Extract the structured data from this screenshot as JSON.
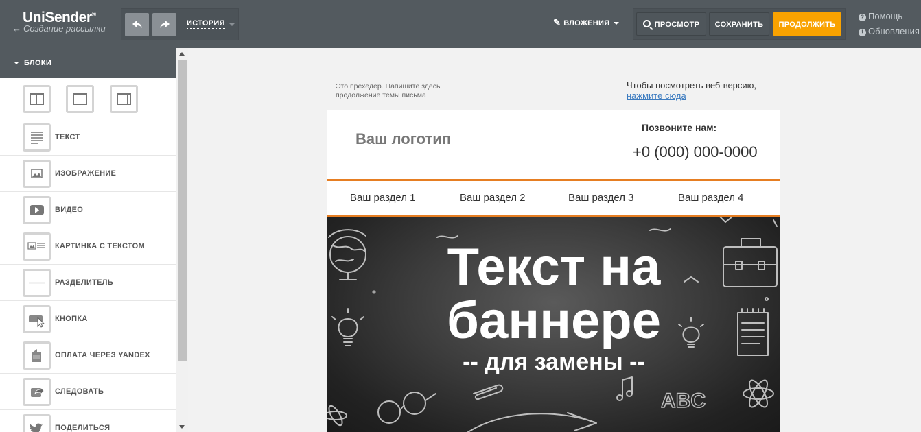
{
  "app": {
    "logo": "UniSender",
    "logo_mark": "®",
    "back_link": "Создание рассылки"
  },
  "history": {
    "label": "ИСТОРИЯ"
  },
  "toolbar": {
    "attachments_label": "ВЛОЖЕНИЯ",
    "preview_label": "ПРОСМОТР",
    "save_label": "СОХРАНИТЬ",
    "continue_label": "ПРОДОЛЖИТЬ"
  },
  "help": {
    "help_label": "Помощь",
    "updates_label": "Обновления"
  },
  "sidebar": {
    "section_title": "БЛОКИ",
    "items": [
      {
        "label": "ТЕКСТ",
        "icon": "text-icon"
      },
      {
        "label": "ИЗОБРАЖЕНИЕ",
        "icon": "image-icon"
      },
      {
        "label": "ВИДЕО",
        "icon": "video-icon"
      },
      {
        "label": "КАРТИНКА С ТЕКСТОМ",
        "icon": "image-text-icon"
      },
      {
        "label": "РАЗДЕЛИТЕЛЬ",
        "icon": "divider-icon"
      },
      {
        "label": "КНОПКА",
        "icon": "button-icon"
      },
      {
        "label": "ОПЛАТА ЧЕРЕЗ YANDEX",
        "icon": "payment-icon"
      },
      {
        "label": "СЛЕДОВАТЬ",
        "icon": "follow-icon"
      },
      {
        "label": "ПОДЕЛИТЬСЯ",
        "icon": "share-icon"
      }
    ]
  },
  "email": {
    "preheader_left": "Это прехедер. Напишите здесь продолжение темы письма",
    "preheader_right": "Чтобы посмотреть веб-версию,",
    "preheader_link": "нажмите сюда",
    "logo_placeholder": "Ваш логотип",
    "call_label": "Позвоните нам:",
    "phone": "+0 (000) 000-0000",
    "nav": [
      "Ваш раздел 1",
      "Ваш раздел 2",
      "Ваш раздел 3",
      "Ваш раздел 4"
    ],
    "banner": {
      "line1": "Текст на",
      "line2": "баннере",
      "line3": "-- для замены --"
    }
  },
  "colors": {
    "topbar": "#535a5f",
    "accent": "#f9a200",
    "nav_border": "#e67e22",
    "link": "#3d7cc0"
  }
}
